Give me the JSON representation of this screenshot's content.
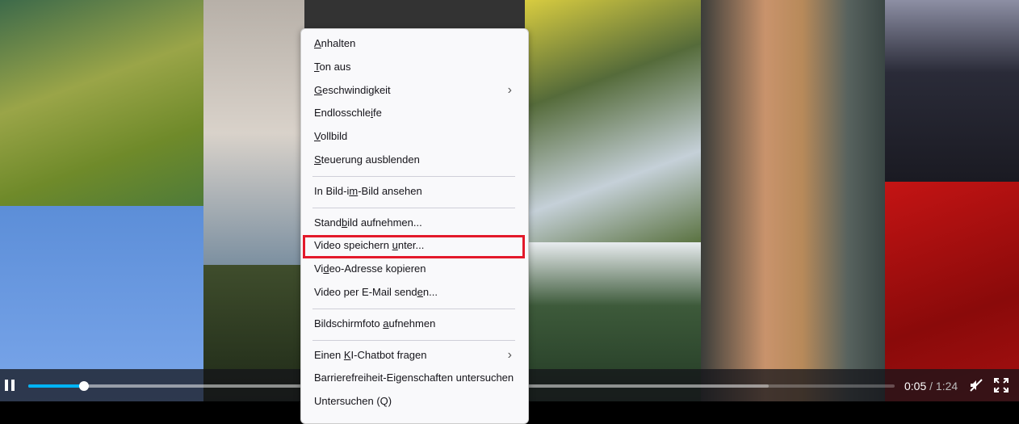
{
  "menu": {
    "items": [
      {
        "label": "Anhalten",
        "accel": 0
      },
      {
        "label": "Ton aus",
        "accel": 0
      },
      {
        "label": "Geschwindigkeit",
        "accel": 0,
        "submenu": true
      },
      {
        "label": "Endlosschleife",
        "accel": 11
      },
      {
        "label": "Vollbild",
        "accel": 0
      },
      {
        "label": "Steuerung ausblenden",
        "accel": 0
      },
      {
        "sep": true
      },
      {
        "label": "In Bild-im-Bild ansehen",
        "accel": 9
      },
      {
        "sep": true
      },
      {
        "label": "Standbild aufnehmen...",
        "accel": 5
      },
      {
        "label": "Video speichern unter...",
        "accel": 16,
        "highlighted": true
      },
      {
        "label": "Video-Adresse kopieren",
        "accel": 2
      },
      {
        "label": "Video per E-Mail senden...",
        "accel": 21
      },
      {
        "sep": true
      },
      {
        "label": "Bildschirmfoto aufnehmen",
        "accel": 15
      },
      {
        "sep": true
      },
      {
        "label": "Einen KI-Chatbot fragen",
        "accel": 6,
        "submenu": true
      },
      {
        "label": "Barrierefreiheit-Eigenschaften untersuchen",
        "accel": -1
      },
      {
        "label": "Untersuchen (Q)",
        "accel": -1
      }
    ]
  },
  "player": {
    "current_time": "0:05",
    "separator": " / ",
    "total_time": "1:24",
    "progress_fraction": 0.064,
    "buffered_fraction": 0.855
  },
  "colors": {
    "accent": "#00b3f4",
    "highlight_box": "#e3192a"
  }
}
